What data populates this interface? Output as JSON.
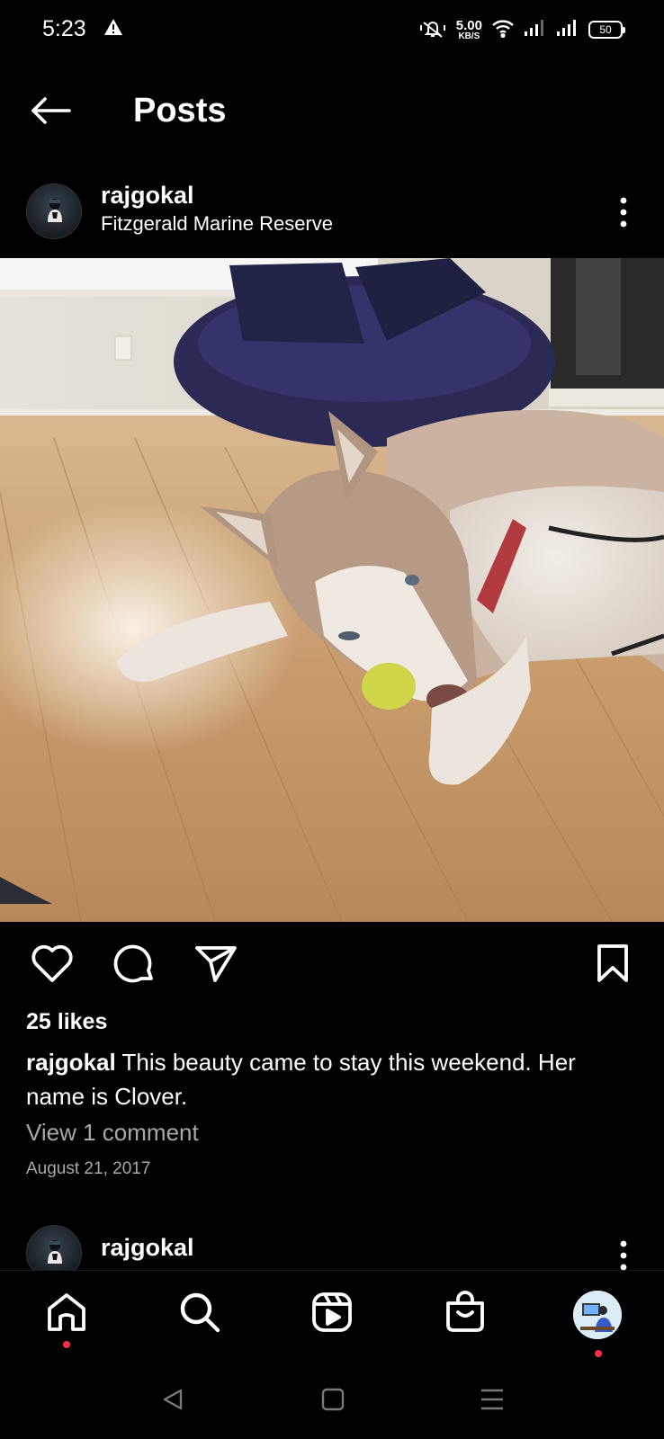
{
  "status_bar": {
    "time": "5:23",
    "net_speed_value": "5.00",
    "net_speed_unit": "KB/S",
    "battery_level": "50"
  },
  "header": {
    "title": "Posts"
  },
  "post": {
    "username": "rajgokal",
    "location": "Fitzgerald Marine Reserve",
    "likes": "25 likes",
    "caption_user": "rajgokal",
    "caption_text": "This beauty came to stay this weekend. Her name is Clover.",
    "view_comments": "View 1 comment",
    "date": "August 21, 2017"
  },
  "next_post": {
    "username": "rajgokal"
  },
  "icons": {
    "back": "arrow-left",
    "more": "three-dots-vertical",
    "like": "heart-outline",
    "comment": "speech-bubble-outline",
    "share": "paper-plane-outline",
    "save": "bookmark-outline",
    "nav_home": "home",
    "nav_search": "search",
    "nav_reels": "reels",
    "nav_shop": "shopping-bag"
  },
  "colors": {
    "background": "#000000",
    "text": "#ffffff",
    "secondary_text": "#a8a8a8",
    "notification_dot": "#ff3040"
  }
}
